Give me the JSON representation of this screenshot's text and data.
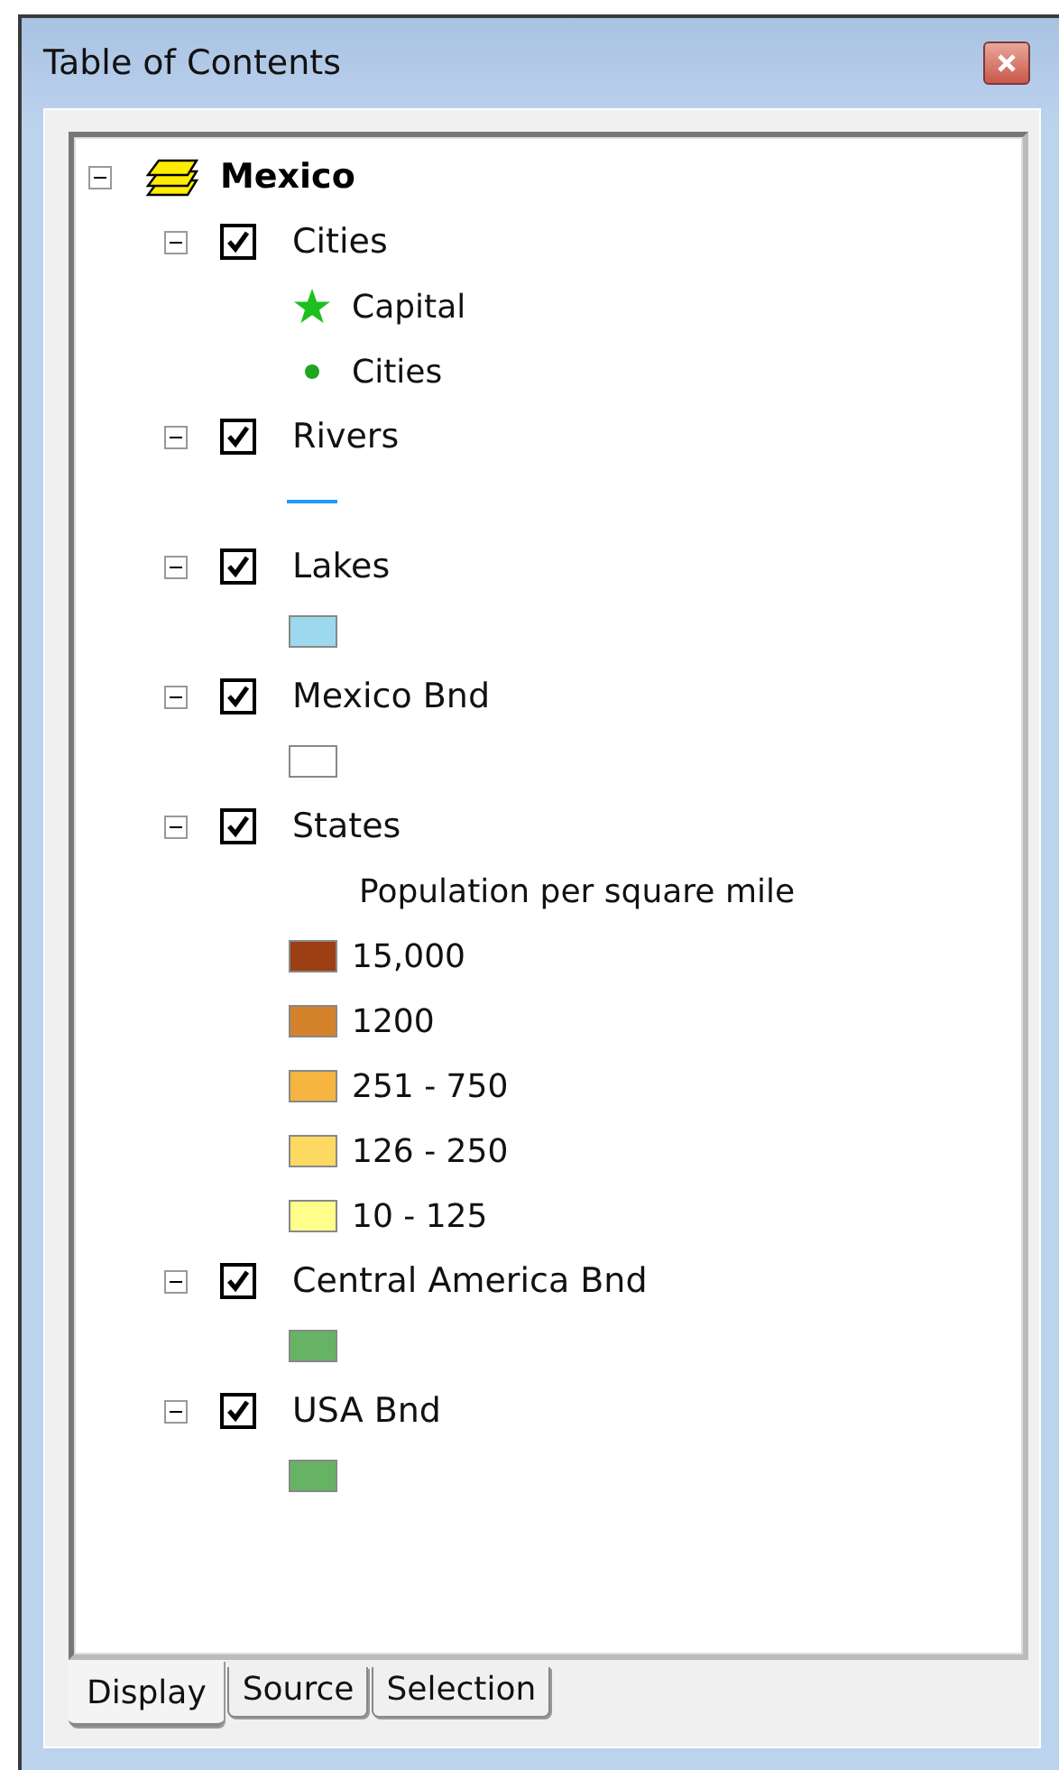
{
  "window": {
    "title": "Table of Contents"
  },
  "tree": {
    "label": "Mexico",
    "expanded": true,
    "layers": [
      {
        "label": "Cities",
        "expanded": true,
        "checked": true,
        "legend": [
          {
            "kind": "star",
            "label": "Capital",
            "color": "#1fbf1f"
          },
          {
            "kind": "dot",
            "label": "Cities",
            "color": "#1fa51f"
          }
        ]
      },
      {
        "label": "Rivers",
        "expanded": true,
        "checked": true,
        "legend": [
          {
            "kind": "line",
            "color": "#1e9bff"
          }
        ]
      },
      {
        "label": "Lakes",
        "expanded": true,
        "checked": true,
        "legend": [
          {
            "kind": "fill",
            "color": "#9dd9ee"
          }
        ]
      },
      {
        "label": "Mexico Bnd",
        "expanded": true,
        "checked": true,
        "legend": [
          {
            "kind": "fill",
            "color": "#ffffff"
          }
        ]
      },
      {
        "label": "States",
        "expanded": true,
        "checked": true,
        "legend": [
          {
            "kind": "heading",
            "label": "Population per square mile"
          },
          {
            "kind": "fill",
            "label": "15,000",
            "color": "#9c3f12"
          },
          {
            "kind": "fill",
            "label": "1200",
            "color": "#d4832a"
          },
          {
            "kind": "fill",
            "label": "251 - 750",
            "color": "#f5b540"
          },
          {
            "kind": "fill",
            "label": "126 - 250",
            "color": "#fdd962"
          },
          {
            "kind": "fill",
            "label": "10 - 125",
            "color": "#fefe8a"
          }
        ]
      },
      {
        "label": "Central America Bnd",
        "expanded": true,
        "checked": true,
        "legend": [
          {
            "kind": "fill",
            "color": "#66b366"
          }
        ]
      },
      {
        "label": "USA Bnd",
        "expanded": true,
        "checked": true,
        "legend": [
          {
            "kind": "fill",
            "color": "#66b366"
          }
        ]
      }
    ]
  },
  "tabs": [
    {
      "label": "Display",
      "selected": true
    },
    {
      "label": "Source",
      "selected": false
    },
    {
      "label": "Selection",
      "selected": false
    }
  ]
}
